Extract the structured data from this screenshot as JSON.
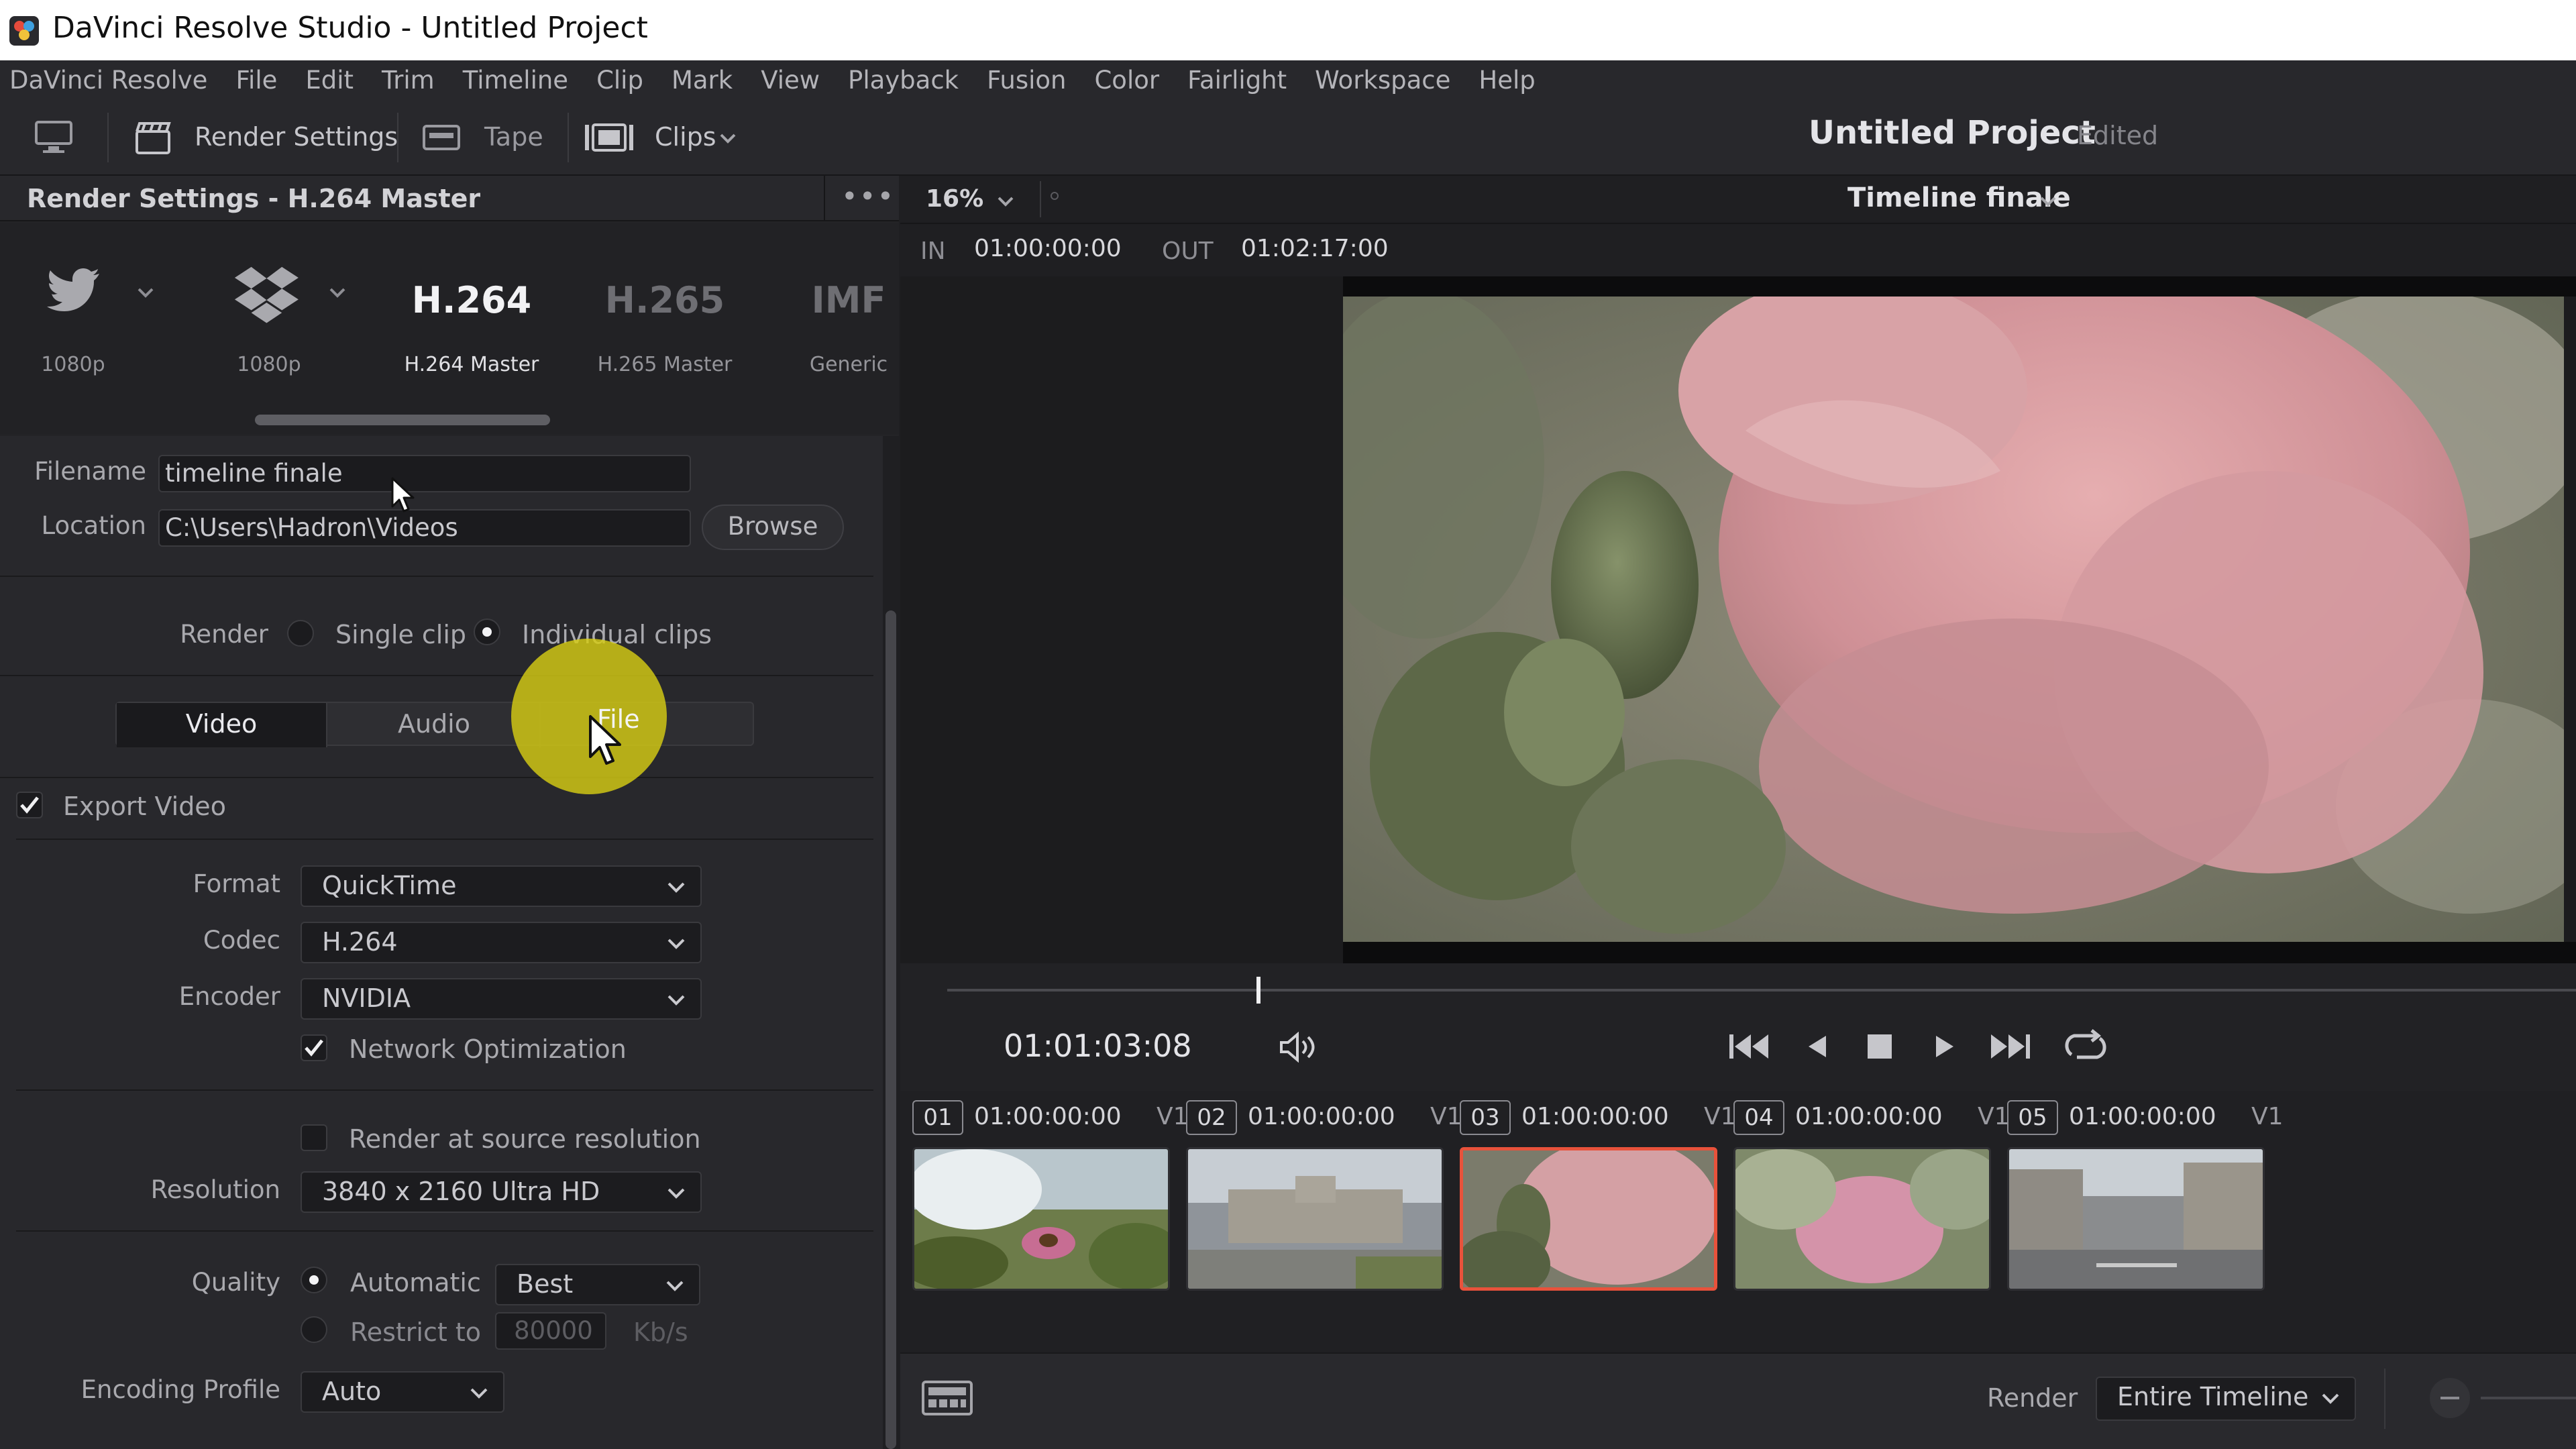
{
  "window": {
    "title": "DaVinci Resolve Studio - Untitled Project"
  },
  "menu": [
    "DaVinci Resolve",
    "File",
    "Edit",
    "Trim",
    "Timeline",
    "Clip",
    "Mark",
    "View",
    "Playback",
    "Fusion",
    "Color",
    "Fairlight",
    "Workspace",
    "Help"
  ],
  "toolbar": {
    "render_settings": "Render Settings",
    "tape": "Tape",
    "clips": "Clips",
    "project_title": "Untitled Project",
    "project_status": "Edited"
  },
  "panel": {
    "header": "Render Settings - H.264 Master",
    "more": "•••"
  },
  "presets": [
    {
      "big": "",
      "label": "1080p",
      "icon": "twitter-icon"
    },
    {
      "big": "",
      "label": "1080p",
      "icon": "dropbox-icon"
    },
    {
      "big": "H.264",
      "label": "H.264 Master"
    },
    {
      "big": "H.265",
      "label": "H.265 Master"
    },
    {
      "big": "IMF",
      "label": "Generic"
    }
  ],
  "file": {
    "filename_label": "Filename",
    "filename_value": "timeline finale",
    "location_label": "Location",
    "location_value": "C:\\Users\\Hadron\\Videos",
    "browse": "Browse"
  },
  "render_mode": {
    "label": "Render",
    "single": "Single clip",
    "individual": "Individual clips",
    "selected": "individual"
  },
  "tabs": {
    "video": "Video",
    "audio": "Audio",
    "file": "File",
    "active": "video"
  },
  "video": {
    "export_video": "Export Video",
    "format_label": "Format",
    "format_value": "QuickTime",
    "codec_label": "Codec",
    "codec_value": "H.264",
    "encoder_label": "Encoder",
    "encoder_value": "NVIDIA",
    "network_opt": "Network Optimization",
    "render_source": "Render at source resolution",
    "resolution_label": "Resolution",
    "resolution_value": "3840 x 2160 Ultra HD",
    "quality_label": "Quality",
    "automatic": "Automatic",
    "automatic_value": "Best",
    "restrict": "Restrict to",
    "restrict_value": "80000",
    "restrict_unit": "Kb/s",
    "encoding_profile_label": "Encoding Profile",
    "encoding_profile_value": "Auto"
  },
  "viewer": {
    "zoom": "16%",
    "timeline_name": "Timeline finale",
    "in_label": "IN",
    "in_tc": "01:00:00:00",
    "out_label": "OUT",
    "out_tc": "01:02:17:00",
    "current_tc": "01:01:03:08",
    "scrub_position": 0.19
  },
  "clips": [
    {
      "num": "01",
      "tc": "01:00:00:00",
      "track": "V1",
      "selected": false
    },
    {
      "num": "02",
      "tc": "01:00:00:00",
      "track": "V1",
      "selected": false
    },
    {
      "num": "03",
      "tc": "01:00:00:00",
      "track": "V1",
      "selected": true
    },
    {
      "num": "04",
      "tc": "01:00:00:00",
      "track": "V1",
      "selected": false
    },
    {
      "num": "05",
      "tc": "01:00:00:00",
      "track": "V1",
      "selected": false
    }
  ],
  "bottom": {
    "render_label": "Render",
    "render_value": "Entire Timeline"
  },
  "colors": {
    "accent_selected": "#e8523b",
    "background": "#1f1f22",
    "highlight": "#d6cc14"
  }
}
